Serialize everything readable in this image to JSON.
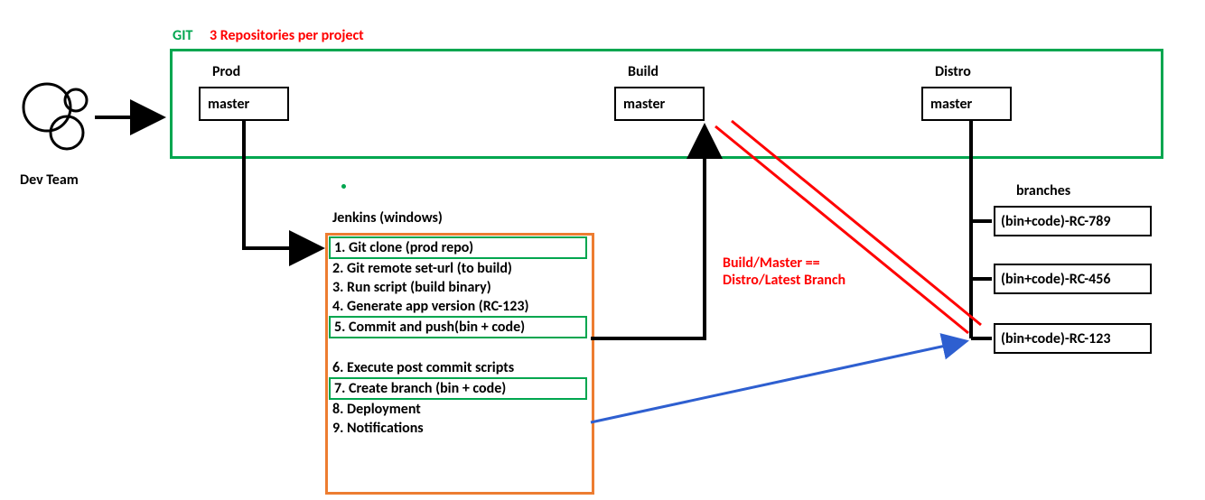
{
  "header": {
    "git_label": "GIT",
    "repos_label": "3 Repositories per project"
  },
  "devteam": {
    "label": "Dev Team"
  },
  "repos": {
    "prod": {
      "title": "Prod",
      "branch": "master"
    },
    "build": {
      "title": "Build",
      "branch": "master"
    },
    "distro": {
      "title": "Distro",
      "branch": "master"
    }
  },
  "jenkins": {
    "title": "Jenkins (windows)",
    "steps": {
      "s1": "1. Git clone (prod repo)",
      "s2": "2. Git remote set-url (to build)",
      "s3": "3. Run script (build binary)",
      "s4": "4. Generate app version (RC-123)",
      "s5": "5. Commit and push(bin + code)",
      "s6": "6. Execute post commit scripts",
      "s7": "7. Create branch (bin + code)",
      "s8": "8. Deployment",
      "s9": "9. Notifications"
    }
  },
  "branches": {
    "title": "branches",
    "b1": "(bin+code)-RC-789",
    "b2": "(bin+code)-RC-456",
    "b3": "(bin+code)-RC-123"
  },
  "note": {
    "line1": "Build/Master ==",
    "line2": "Distro/Latest Branch"
  }
}
